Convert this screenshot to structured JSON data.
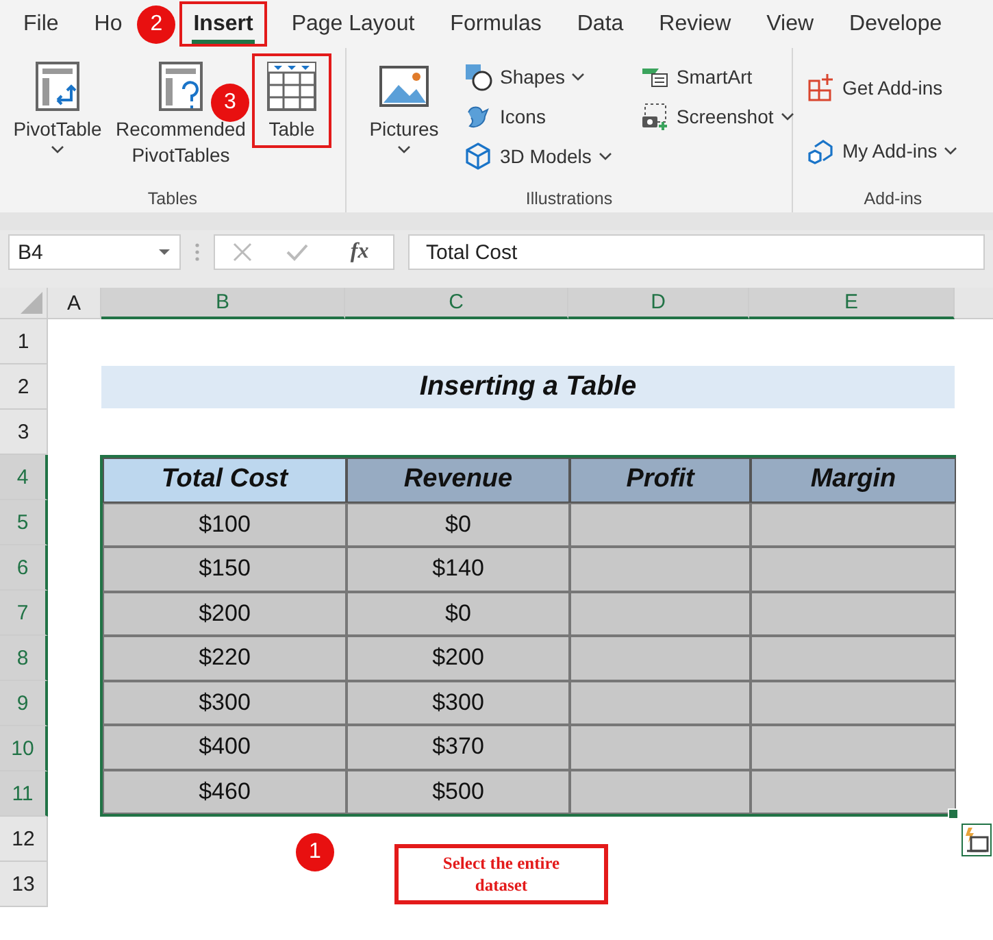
{
  "ribbon_tabs": [
    {
      "label": "File",
      "selected": false
    },
    {
      "label": "Ho",
      "selected": false
    },
    {
      "label": "Insert",
      "selected": true,
      "callout": "2"
    },
    {
      "label": "Page Layout",
      "selected": false
    },
    {
      "label": "Formulas",
      "selected": false
    },
    {
      "label": "Data",
      "selected": false
    },
    {
      "label": "Review",
      "selected": false
    },
    {
      "label": "View",
      "selected": false
    },
    {
      "label": "Develope",
      "selected": false
    }
  ],
  "ribbon_groups": [
    {
      "label": "Tables",
      "commands": [
        {
          "label": "PivotTable",
          "kind": "large",
          "dropdown": true
        },
        {
          "label": "Recommended PivotTables",
          "kind": "large",
          "dropdown": false
        },
        {
          "label": "Table",
          "kind": "large",
          "dropdown": false,
          "callout": "3"
        }
      ]
    },
    {
      "label": "Illustrations",
      "commands": [
        {
          "label": "Pictures",
          "kind": "large",
          "dropdown": true
        },
        {
          "label": "Shapes",
          "kind": "small",
          "dropdown": true
        },
        {
          "label": "Icons",
          "kind": "small",
          "dropdown": false
        },
        {
          "label": "3D Models",
          "kind": "small",
          "dropdown": true
        },
        {
          "label": "SmartArt",
          "kind": "small",
          "dropdown": false
        },
        {
          "label": "Screenshot",
          "kind": "small",
          "dropdown": true
        }
      ]
    },
    {
      "label": "Add-ins",
      "commands": [
        {
          "label": "Get Add-ins",
          "kind": "small",
          "dropdown": false
        },
        {
          "label": "My Add-ins",
          "kind": "small",
          "dropdown": true
        }
      ]
    }
  ],
  "name_box": "B4",
  "function_label": "fx",
  "formula": "Total Cost",
  "column_headers": [
    {
      "label": "A",
      "selected": false
    },
    {
      "label": "B",
      "selected": true
    },
    {
      "label": "C",
      "selected": true
    },
    {
      "label": "D",
      "selected": true
    },
    {
      "label": "E",
      "selected": true
    }
  ],
  "row_headers": [
    {
      "label": "1",
      "selected": false
    },
    {
      "label": "2",
      "selected": false
    },
    {
      "label": "3",
      "selected": false
    },
    {
      "label": "4",
      "selected": true
    },
    {
      "label": "5",
      "selected": true
    },
    {
      "label": "6",
      "selected": true
    },
    {
      "label": "7",
      "selected": true
    },
    {
      "label": "8",
      "selected": true
    },
    {
      "label": "9",
      "selected": true
    },
    {
      "label": "10",
      "selected": true
    },
    {
      "label": "11",
      "selected": true
    },
    {
      "label": "12",
      "selected": false
    },
    {
      "label": "13",
      "selected": false
    }
  ],
  "sheet_title": "Inserting a Table",
  "table": {
    "columns": [
      {
        "label": "Total Cost",
        "active": true
      },
      {
        "label": "Revenue",
        "active": false
      },
      {
        "label": "Profit",
        "active": false
      },
      {
        "label": "Margin",
        "active": false
      }
    ],
    "rows": [
      [
        "$100",
        "$0",
        "",
        ""
      ],
      [
        "$150",
        "$140",
        "",
        ""
      ],
      [
        "$200",
        "$0",
        "",
        ""
      ],
      [
        "$220",
        "$200",
        "",
        ""
      ],
      [
        "$300",
        "$300",
        "",
        ""
      ],
      [
        "$400",
        "$370",
        "",
        ""
      ],
      [
        "$460",
        "$500",
        "",
        ""
      ]
    ]
  },
  "note": {
    "text": "Select the entire dataset",
    "callout": "1"
  }
}
